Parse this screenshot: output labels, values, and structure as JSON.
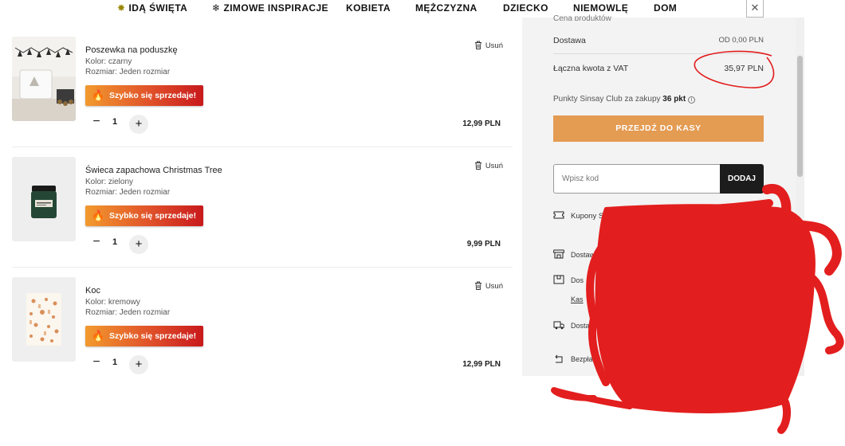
{
  "nav": {
    "items": [
      {
        "label": "IDĄ ŚWIĘTA",
        "icon": "star-icon"
      },
      {
        "label": "ZIMOWE INSPIRACJE",
        "icon": "snowflake-icon"
      },
      {
        "label": "KOBIETA"
      },
      {
        "label": "MĘŻCZYZNA"
      },
      {
        "label": "DZIECKO"
      },
      {
        "label": "NIEMOWLĘ"
      },
      {
        "label": "DOM"
      }
    ],
    "close_glyph": "✕"
  },
  "cart": {
    "remove_label": "Usuń",
    "badge_label": "Szybko się sprzedaje!",
    "items": [
      {
        "name": "Poszewka na poduszkę",
        "color": "Kolor: czarny",
        "size": "Rozmiar: Jeden rozmiar",
        "qty": "1",
        "price": "12,99 PLN"
      },
      {
        "name": "Świeca zapachowa Christmas Tree",
        "color": "Kolor: zielony",
        "size": "Rozmiar: Jeden rozmiar",
        "qty": "1",
        "price": "9,99 PLN"
      },
      {
        "name": "Koc",
        "color": "Kolor: kremowy",
        "size": "Rozmiar: Jeden rozmiar",
        "qty": "1",
        "price": "12,99 PLN"
      }
    ]
  },
  "summary": {
    "delivery_label": "Dostawa",
    "delivery_value": "OD 0,00 PLN",
    "total_label": "Łączna kwota z VAT",
    "total_value": "35,97 PLN",
    "points_prefix": "Punkty Sinsay Club za zakupy",
    "points_value": "36 pkt",
    "checkout_label": "PRZEJDŹ DO KASY",
    "code_placeholder": "Wpisz kod",
    "code_button": "DODAJ",
    "coupons_label": "Kupony Sinsay",
    "benefits": [
      "Dostawa",
      "Dos",
      "Kas",
      "Dostawa produktó",
      "Bezpła"
    ]
  },
  "colors": {
    "checkout_bg": "#e49b52",
    "badge_start": "#f29a2e",
    "badge_end": "#c8191c",
    "annotation_red": "#e31e1e"
  }
}
